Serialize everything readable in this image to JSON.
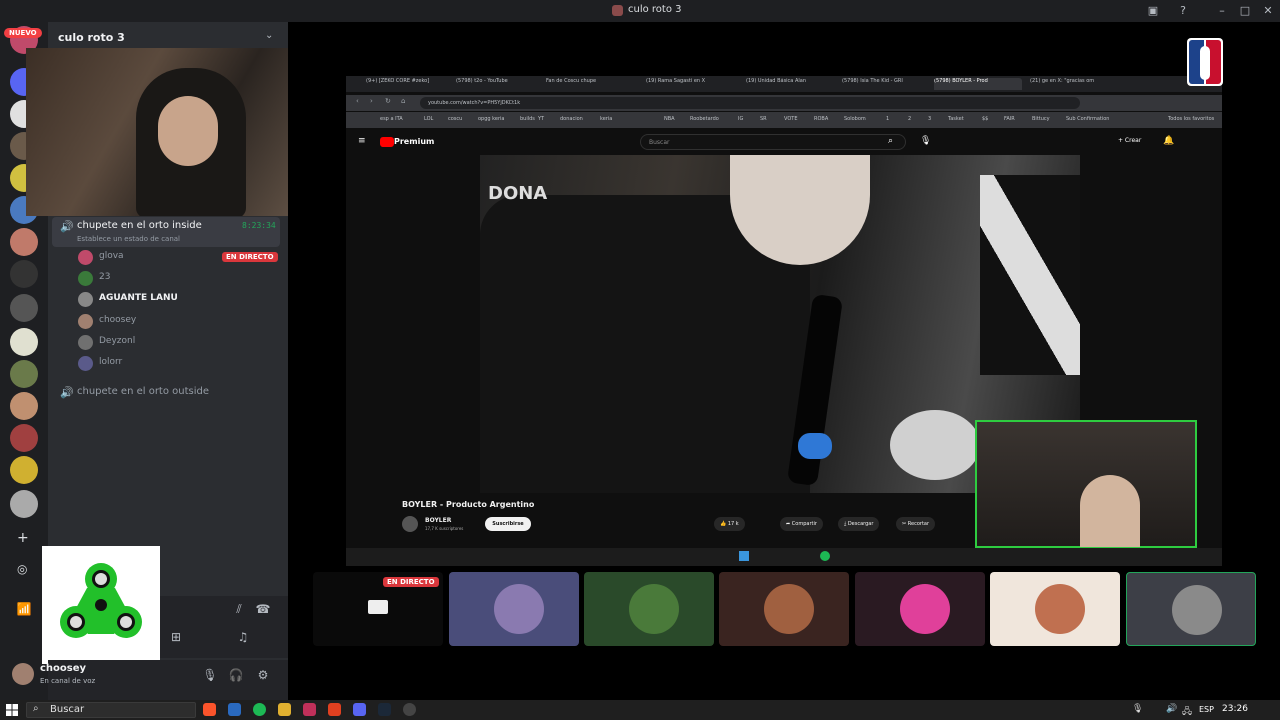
{
  "window": {
    "title": "culo roto 3"
  },
  "server": {
    "name": "culo roto 3",
    "new_badge": "NUEVO"
  },
  "voice_channels": [
    {
      "name": "chupete en el orto inside",
      "time": "8:23:34",
      "status": "Establece un estado de canal",
      "live_badge": "EN DIRECTO",
      "members": [
        {
          "name": "glova",
          "color": "#c04a6a"
        },
        {
          "name": "23",
          "color": "#3a7a3a"
        },
        {
          "name": "AGUANTE LANU",
          "color": "#888888"
        },
        {
          "name": "choosey",
          "color": "#a08070"
        },
        {
          "name": "Deyzonl",
          "color": "#707070"
        },
        {
          "name": "lolorr",
          "color": "#5a5a8a"
        }
      ]
    },
    {
      "name": "chupete en el orto outside"
    }
  ],
  "user": {
    "name": "choosey",
    "status": "En canal de voz"
  },
  "browser": {
    "tabs": [
      "(9+) [ZEKO CORE #zeko]",
      "(5798) t2o - YouTube",
      "Fan de Coscu chupe",
      "(19) Rama Sagasti en X",
      "(19) Unidad Básica Alan",
      "(5798) Isia The Kid - GRI",
      "(5798) BOYLER - Prod",
      "(21) ge en X: \"gracias om"
    ],
    "url": "youtube.com/watch?v=PH5YjDKCt1k",
    "bookmarks": [
      "esp a ITA",
      "LOL",
      "coscu",
      "opgg keria",
      "builds",
      "YT",
      "donacion",
      "keria",
      "NBA",
      "Roobetardo",
      "IG",
      "SR",
      "VOTE",
      "ROBA",
      "Solobom",
      "1",
      "2",
      "3",
      "Tasket",
      "$$",
      "FAIR",
      "Bittucy",
      "Sub Confirmation",
      "Todos los favoritos"
    ]
  },
  "youtube": {
    "brand": "Premium",
    "search_placeholder": "Buscar",
    "create_label": "+ Crear",
    "video_text": "DONA",
    "title": "BOYLER - Producto Argentino",
    "channel": "BOYLER",
    "subscribers": "17,7 K suscriptores",
    "subscribe_label": "Suscribirse",
    "likes": "17 k",
    "share_label": "Compartir",
    "download_label": "Descargar",
    "clip_label": "Recortar"
  },
  "tiles": {
    "live_badge": "EN DIRECTO",
    "items": [
      {
        "name": "stream",
        "bg": "#0a0a0a",
        "pic": "#cccccc"
      },
      {
        "name": "avatar-purple",
        "bg": "#4a4d7a",
        "pic": "#8a7ab0"
      },
      {
        "name": "avatar-green",
        "bg": "#2a4a2a",
        "pic": "#4a7a3a"
      },
      {
        "name": "avatar-anime",
        "bg": "#3a2420",
        "pic": "#a06040"
      },
      {
        "name": "avatar-pink",
        "bg": "#2a1a22",
        "pic": "#e0409a"
      },
      {
        "name": "avatar-group",
        "bg": "#f0e6dc",
        "pic": "#c07050"
      },
      {
        "name": "avatar-pug",
        "bg": "#3d3f47",
        "pic": "#8a8a8a"
      }
    ]
  },
  "taskbar": {
    "search_label": "Buscar",
    "lang": "ESP",
    "time": "23:26"
  }
}
